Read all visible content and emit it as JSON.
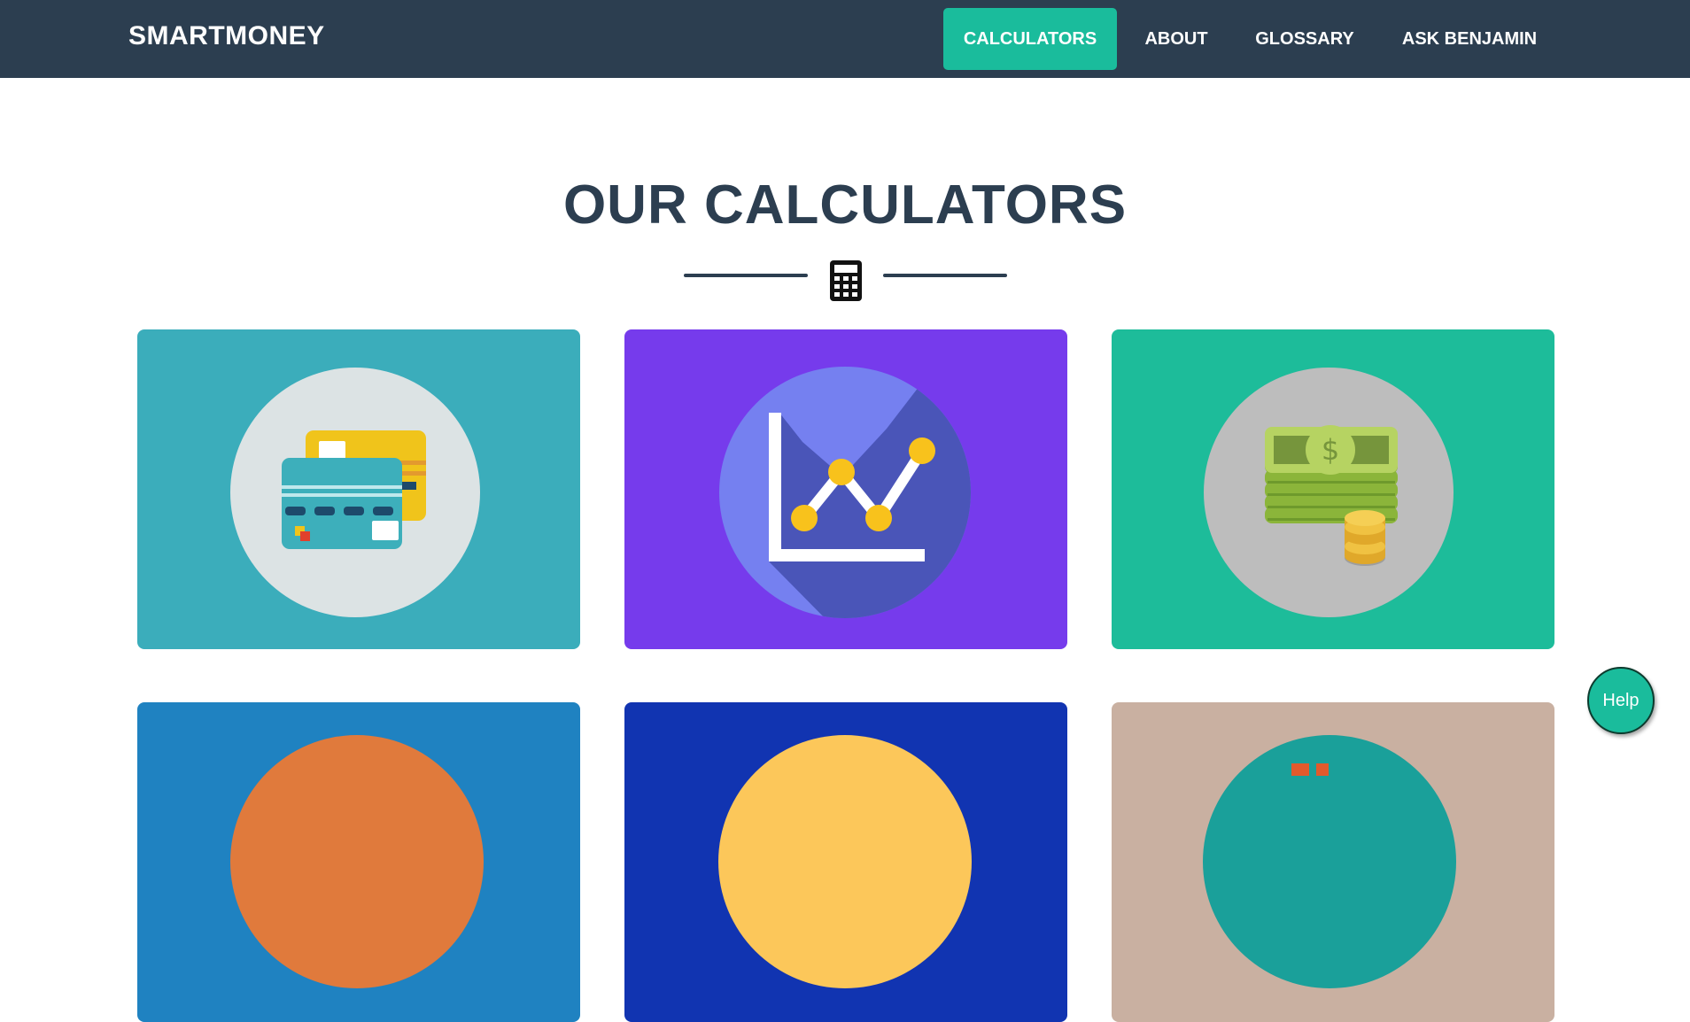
{
  "brand": "SMARTMONEY",
  "nav": {
    "items": [
      {
        "label": "CALCULATORS",
        "active": true
      },
      {
        "label": "ABOUT",
        "active": false
      },
      {
        "label": "GLOSSARY",
        "active": false
      },
      {
        "label": "ASK BENJAMIN",
        "active": false
      }
    ]
  },
  "section": {
    "title": "OUR CALCULATORS",
    "divider_icon": "calculator-icon"
  },
  "cards": [
    {
      "icon": "credit-cards-icon",
      "background": "#3badbb"
    },
    {
      "icon": "line-graph-icon",
      "background": "#763bec"
    },
    {
      "icon": "money-stack-icon",
      "background": "#1dbc9a"
    },
    {
      "icon": "orange-circle-icon",
      "background": "#1f82c1"
    },
    {
      "icon": "yellow-circle-icon",
      "background": "#1134b1"
    },
    {
      "icon": "teal-circle-icon",
      "background": "#c9b0a1"
    }
  ],
  "help": {
    "label": "Help"
  },
  "colors": {
    "navbar": "#2c3e50",
    "accent": "#1abc9c",
    "title": "#2c3e50"
  }
}
